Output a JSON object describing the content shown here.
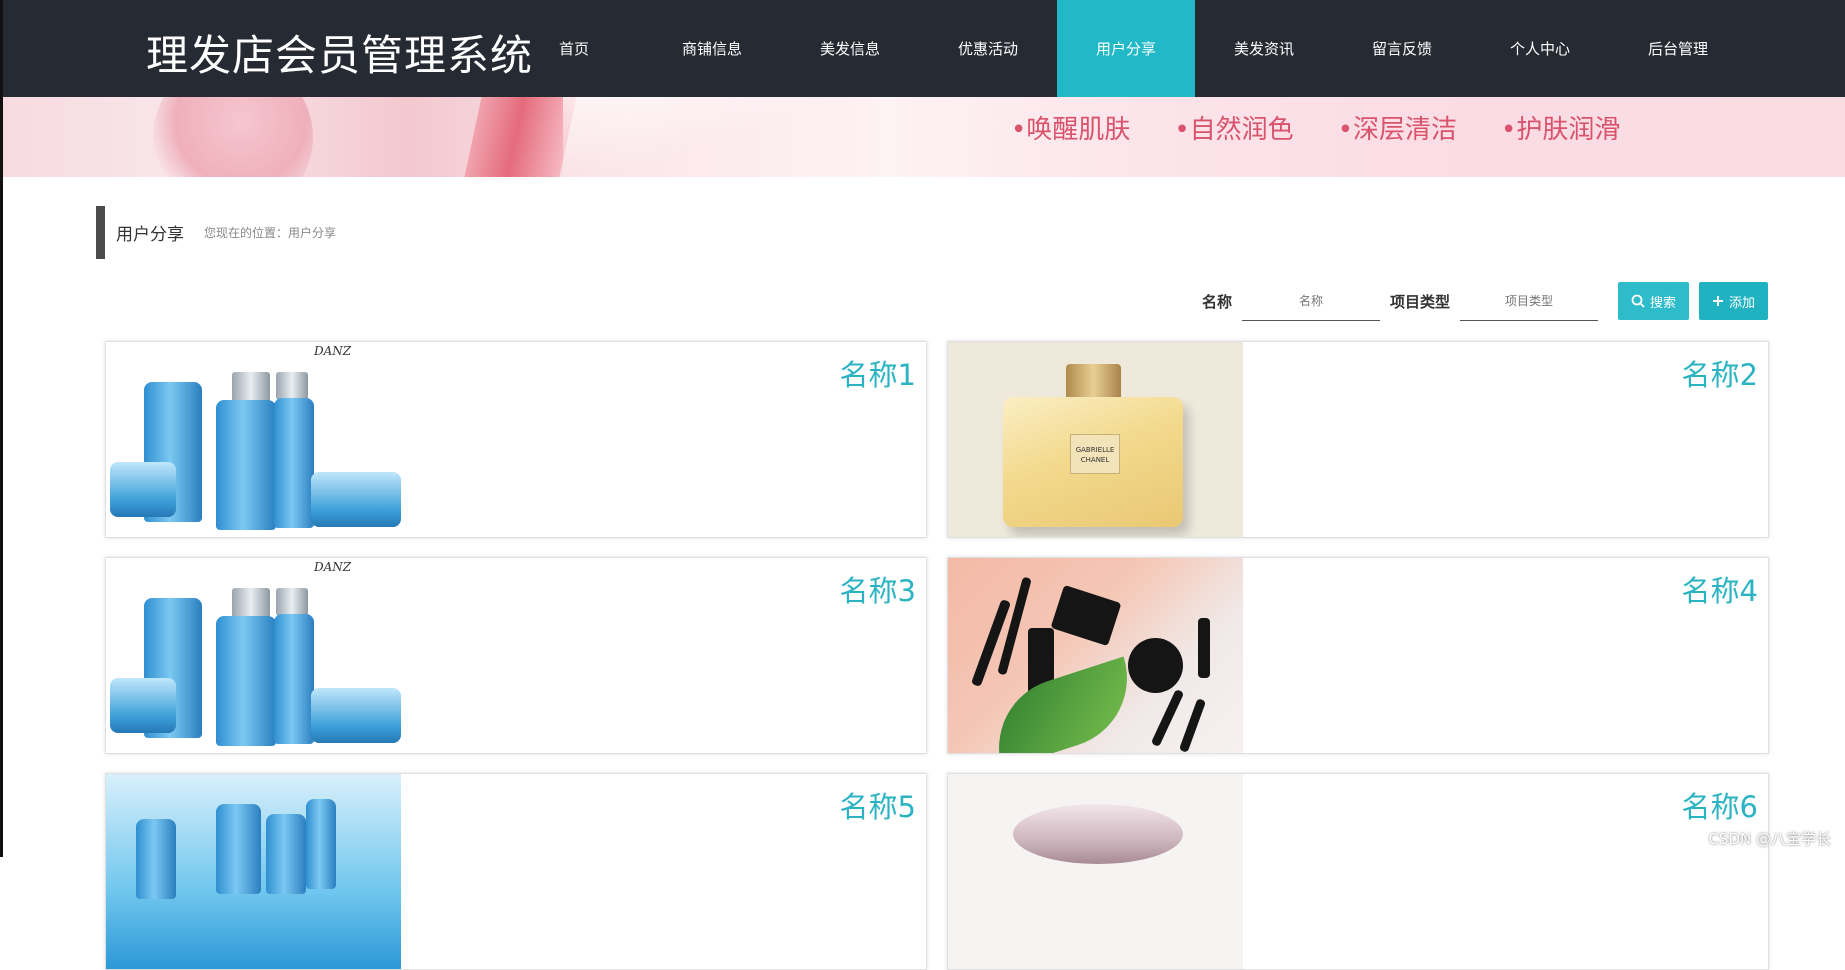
{
  "header": {
    "site_title": "理发店会员管理系统",
    "nav": [
      {
        "label": "首页",
        "active": false
      },
      {
        "label": "商铺信息",
        "active": false
      },
      {
        "label": "美发信息",
        "active": false
      },
      {
        "label": "优惠活动",
        "active": false
      },
      {
        "label": "用户分享",
        "active": true
      },
      {
        "label": "美发资讯",
        "active": false
      },
      {
        "label": "留言反馈",
        "active": false
      },
      {
        "label": "个人中心",
        "active": false
      },
      {
        "label": "后台管理",
        "active": false
      }
    ]
  },
  "banner": {
    "taglines": [
      "•唤醒肌肤",
      "•自然润色",
      "•深层清洁",
      "•护肤润滑"
    ]
  },
  "page": {
    "title": "用户分享",
    "breadcrumb": "您现在的位置：用户分享"
  },
  "search": {
    "name_label": "名称",
    "name_placeholder": "名称",
    "type_label": "项目类型",
    "type_placeholder": "项目类型",
    "search_button": "搜索",
    "add_button": "添加"
  },
  "cards": [
    {
      "name": "名称1",
      "image": "skincare-set"
    },
    {
      "name": "名称2",
      "image": "perfume-bottle"
    },
    {
      "name": "名称3",
      "image": "skincare-set"
    },
    {
      "name": "名称4",
      "image": "makeup-tools"
    },
    {
      "name": "名称5",
      "image": "skincare-water"
    },
    {
      "name": "名称6",
      "image": "pink-perfume"
    }
  ],
  "thumb_text": {
    "brand": "DANZ",
    "perfume_label": "GABRIELLE CHANEL"
  },
  "watermark": "CSDN @八宝学长",
  "colors": {
    "nav_bg": "#262a33",
    "accent": "#21b8c7",
    "card_title": "#2bb3c3",
    "banner_text": "#d9536c"
  }
}
